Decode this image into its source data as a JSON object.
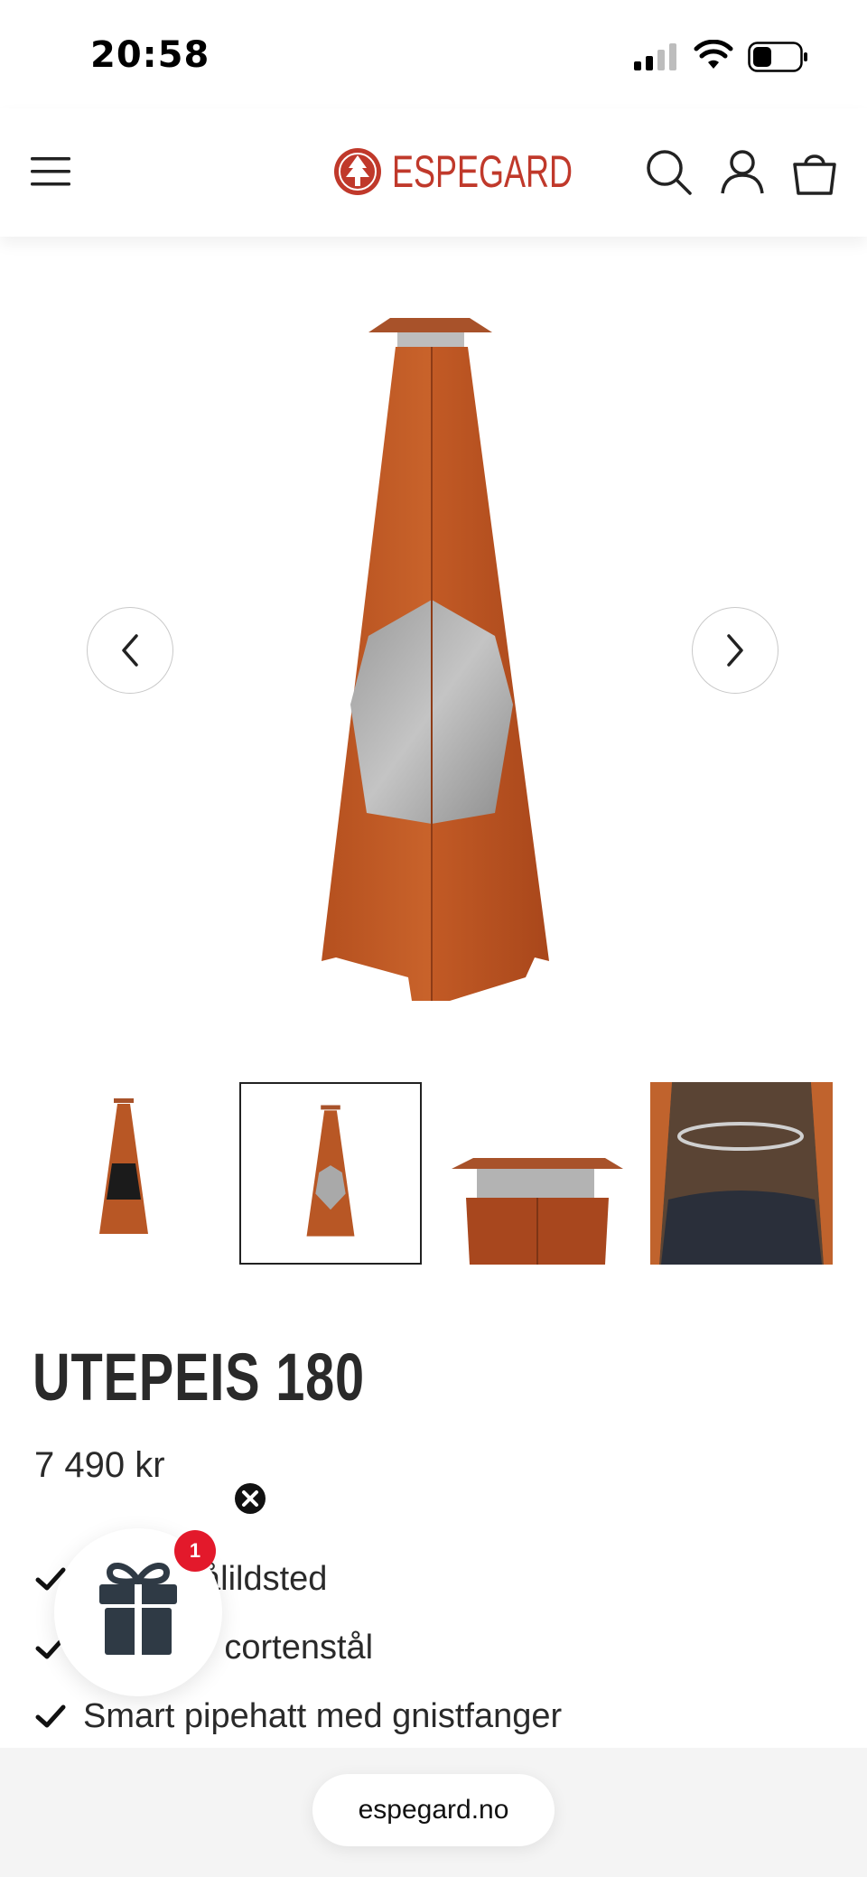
{
  "status_bar": {
    "time": "20:58"
  },
  "header": {
    "logo_text": "ESPEGARD",
    "brand_color": "#c0392b"
  },
  "product": {
    "title": "UTEPEIS 180",
    "price": "7 490 kr",
    "features": [
      "Åpent bålildsted",
      "Laget av cortenstål",
      "Smart pipehatt med gnistfanger"
    ]
  },
  "gallery": {
    "thumbnail_count": 4,
    "selected_index": 1
  },
  "gift_popup": {
    "badge_count": "1"
  },
  "browser": {
    "domain": "espegard.no"
  },
  "icons": [
    "menu-icon",
    "search-icon",
    "user-icon",
    "cart-icon",
    "chevron-left-icon",
    "chevron-right-icon",
    "check-icon",
    "gift-icon",
    "close-icon"
  ]
}
